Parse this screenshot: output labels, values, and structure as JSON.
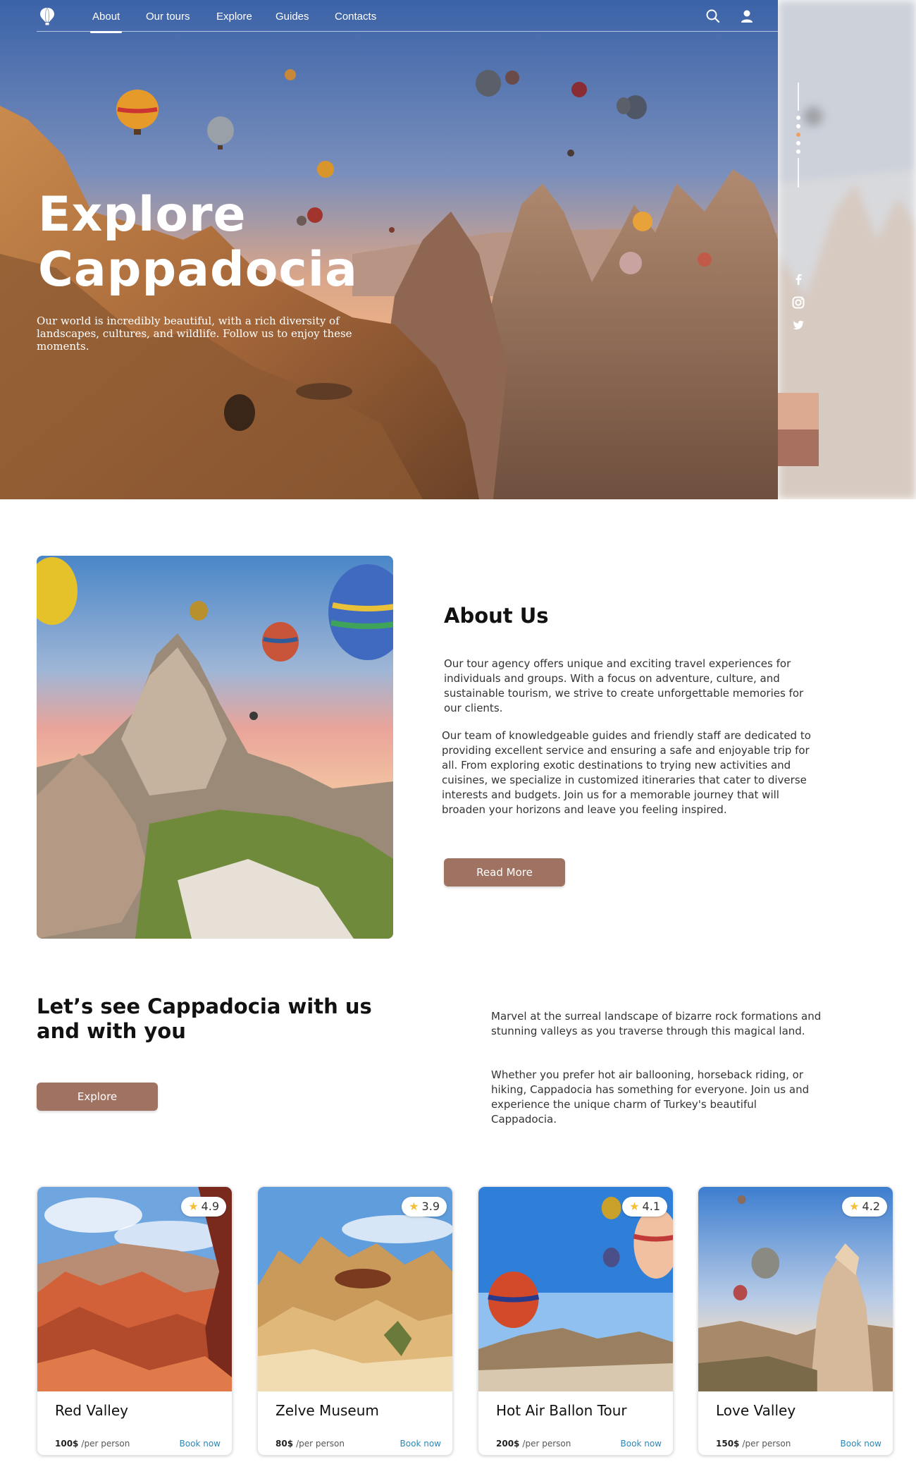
{
  "nav": {
    "items": [
      {
        "label": "About",
        "active": true
      },
      {
        "label": "Our tours",
        "active": false
      },
      {
        "label": "Explore",
        "active": false
      },
      {
        "label": "Guides",
        "active": false
      },
      {
        "label": "Contacts",
        "active": false
      }
    ],
    "icons": [
      "balloon-logo-icon",
      "search-icon",
      "user-icon"
    ]
  },
  "hero": {
    "title_line1": "Explore",
    "title_line2": "Cappadocia",
    "subtitle": "Our world is incredibly beautiful, with a rich diversity of landscapes, cultures, and wildlife. Follow us to enjoy these moments.",
    "social_icons": [
      "facebook-icon",
      "instagram-icon",
      "twitter-icon"
    ],
    "swatch_colors": [
      "#dcaa90",
      "#a8705e"
    ]
  },
  "about": {
    "title": "About Us",
    "paragraph1": "Our tour agency offers unique and exciting travel experiences for individuals and groups. With a focus on adventure, culture, and sustainable tourism, we strive to create unforgettable memories for our clients.",
    "paragraph2": "Our team of knowledgeable guides and friendly staff are dedicated to providing excellent service and ensuring a safe and enjoyable trip for all. From exploring exotic destinations to trying new activities and cuisines, we specialize in customized itineraries that cater to diverse interests and budgets. Join us for a memorable journey that will broaden your horizons and leave you feeling inspired.",
    "button": "Read More"
  },
  "lets_see": {
    "title": "Let’s see Cappadocia with us and with you",
    "button": "Explore",
    "paragraph1": "Marvel at the surreal landscape of bizarre rock formations and stunning valleys as you traverse through this magical land.",
    "paragraph2": "Whether you prefer hot air ballooning, horseback riding, or hiking, Cappadocia has something for everyone. Join us and experience the unique charm of Turkey's beautiful Cappadocia."
  },
  "tours": [
    {
      "title": "Red Valley",
      "rating": "4.9",
      "price": "100$",
      "per": "/per person",
      "book": "Book now"
    },
    {
      "title": "Zelve Museum",
      "rating": "3.9",
      "price": "80$",
      "per": "/per person",
      "book": "Book now"
    },
    {
      "title": "Hot Air Ballon Tour",
      "rating": "4.1",
      "price": "200$",
      "per": "/per person",
      "book": "Book now"
    },
    {
      "title": "Love Valley",
      "rating": "4.2",
      "price": "150$",
      "per": "/per person",
      "book": "Book now"
    }
  ],
  "colors": {
    "accent": "#a07262",
    "link": "#2a88b8",
    "star": "#f5c038"
  }
}
